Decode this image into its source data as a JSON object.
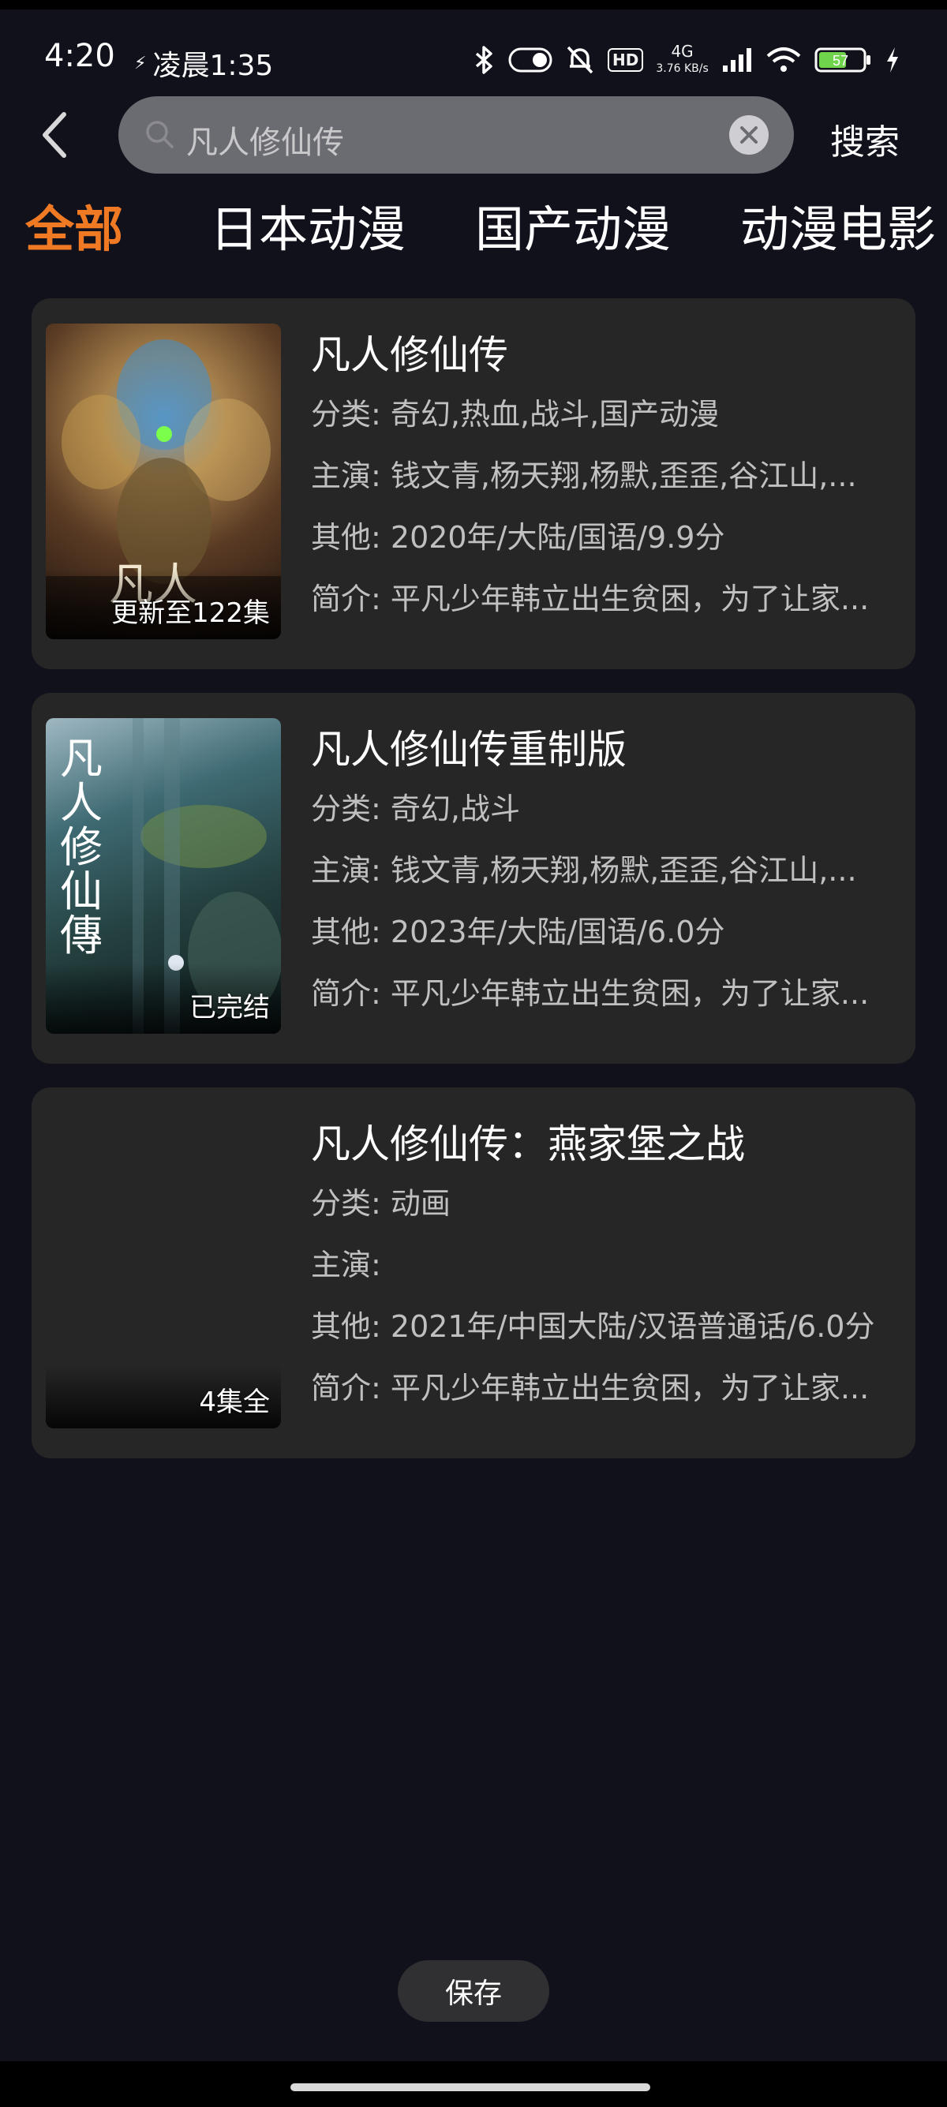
{
  "status_bar": {
    "time": "4:20",
    "alt_clock": "凌晨1:35",
    "network_label": "4G",
    "speed_label": "3.76 KB/s",
    "hd_label": "HD",
    "battery_percent": "57"
  },
  "search": {
    "query": "凡人修仙传",
    "submit_label": "搜索"
  },
  "tabs": [
    {
      "label": "全部",
      "active": true
    },
    {
      "label": "日本动漫",
      "active": false
    },
    {
      "label": "国产动漫",
      "active": false
    },
    {
      "label": "动漫电影",
      "active": false
    }
  ],
  "results": [
    {
      "title": "凡人修仙传",
      "badge": "更新至122集",
      "category_label": "分类:",
      "category": "奇幻,热血,战斗,国产动漫",
      "cast_label": "主演:",
      "cast": "钱文青,杨天翔,杨默,歪歪,谷江山,...",
      "other_label": "其他:",
      "other": "2020年/大陆/国语/9.9分",
      "summary_label": "简介:",
      "summary": "平凡少年韩立出生贫困，为了让家...",
      "poster_text": "凡人"
    },
    {
      "title": "凡人修仙传重制版",
      "badge": "已完结",
      "category_label": "分类:",
      "category": "奇幻,战斗",
      "cast_label": "主演:",
      "cast": "钱文青,杨天翔,杨默,歪歪,谷江山,...",
      "other_label": "其他:",
      "other": "2023年/大陆/国语/6.0分",
      "summary_label": "简介:",
      "summary": "平凡少年韩立出生贫困，为了让家...",
      "poster_text": "凡人修仙傳"
    },
    {
      "title": "凡人修仙传：燕家堡之战",
      "badge": "4集全",
      "category_label": "分类:",
      "category": "动画",
      "cast_label": "主演:",
      "cast": "",
      "other_label": "其他:",
      "other": "2021年/中国大陆/汉语普通话/6.0分",
      "summary_label": "简介:",
      "summary": "平凡少年韩立出生贫困，为了让家...",
      "poster_text": ""
    }
  ],
  "save_label": "保存",
  "colors": {
    "background": "#11111c",
    "accent": "#f07a24",
    "card": "#262626"
  }
}
